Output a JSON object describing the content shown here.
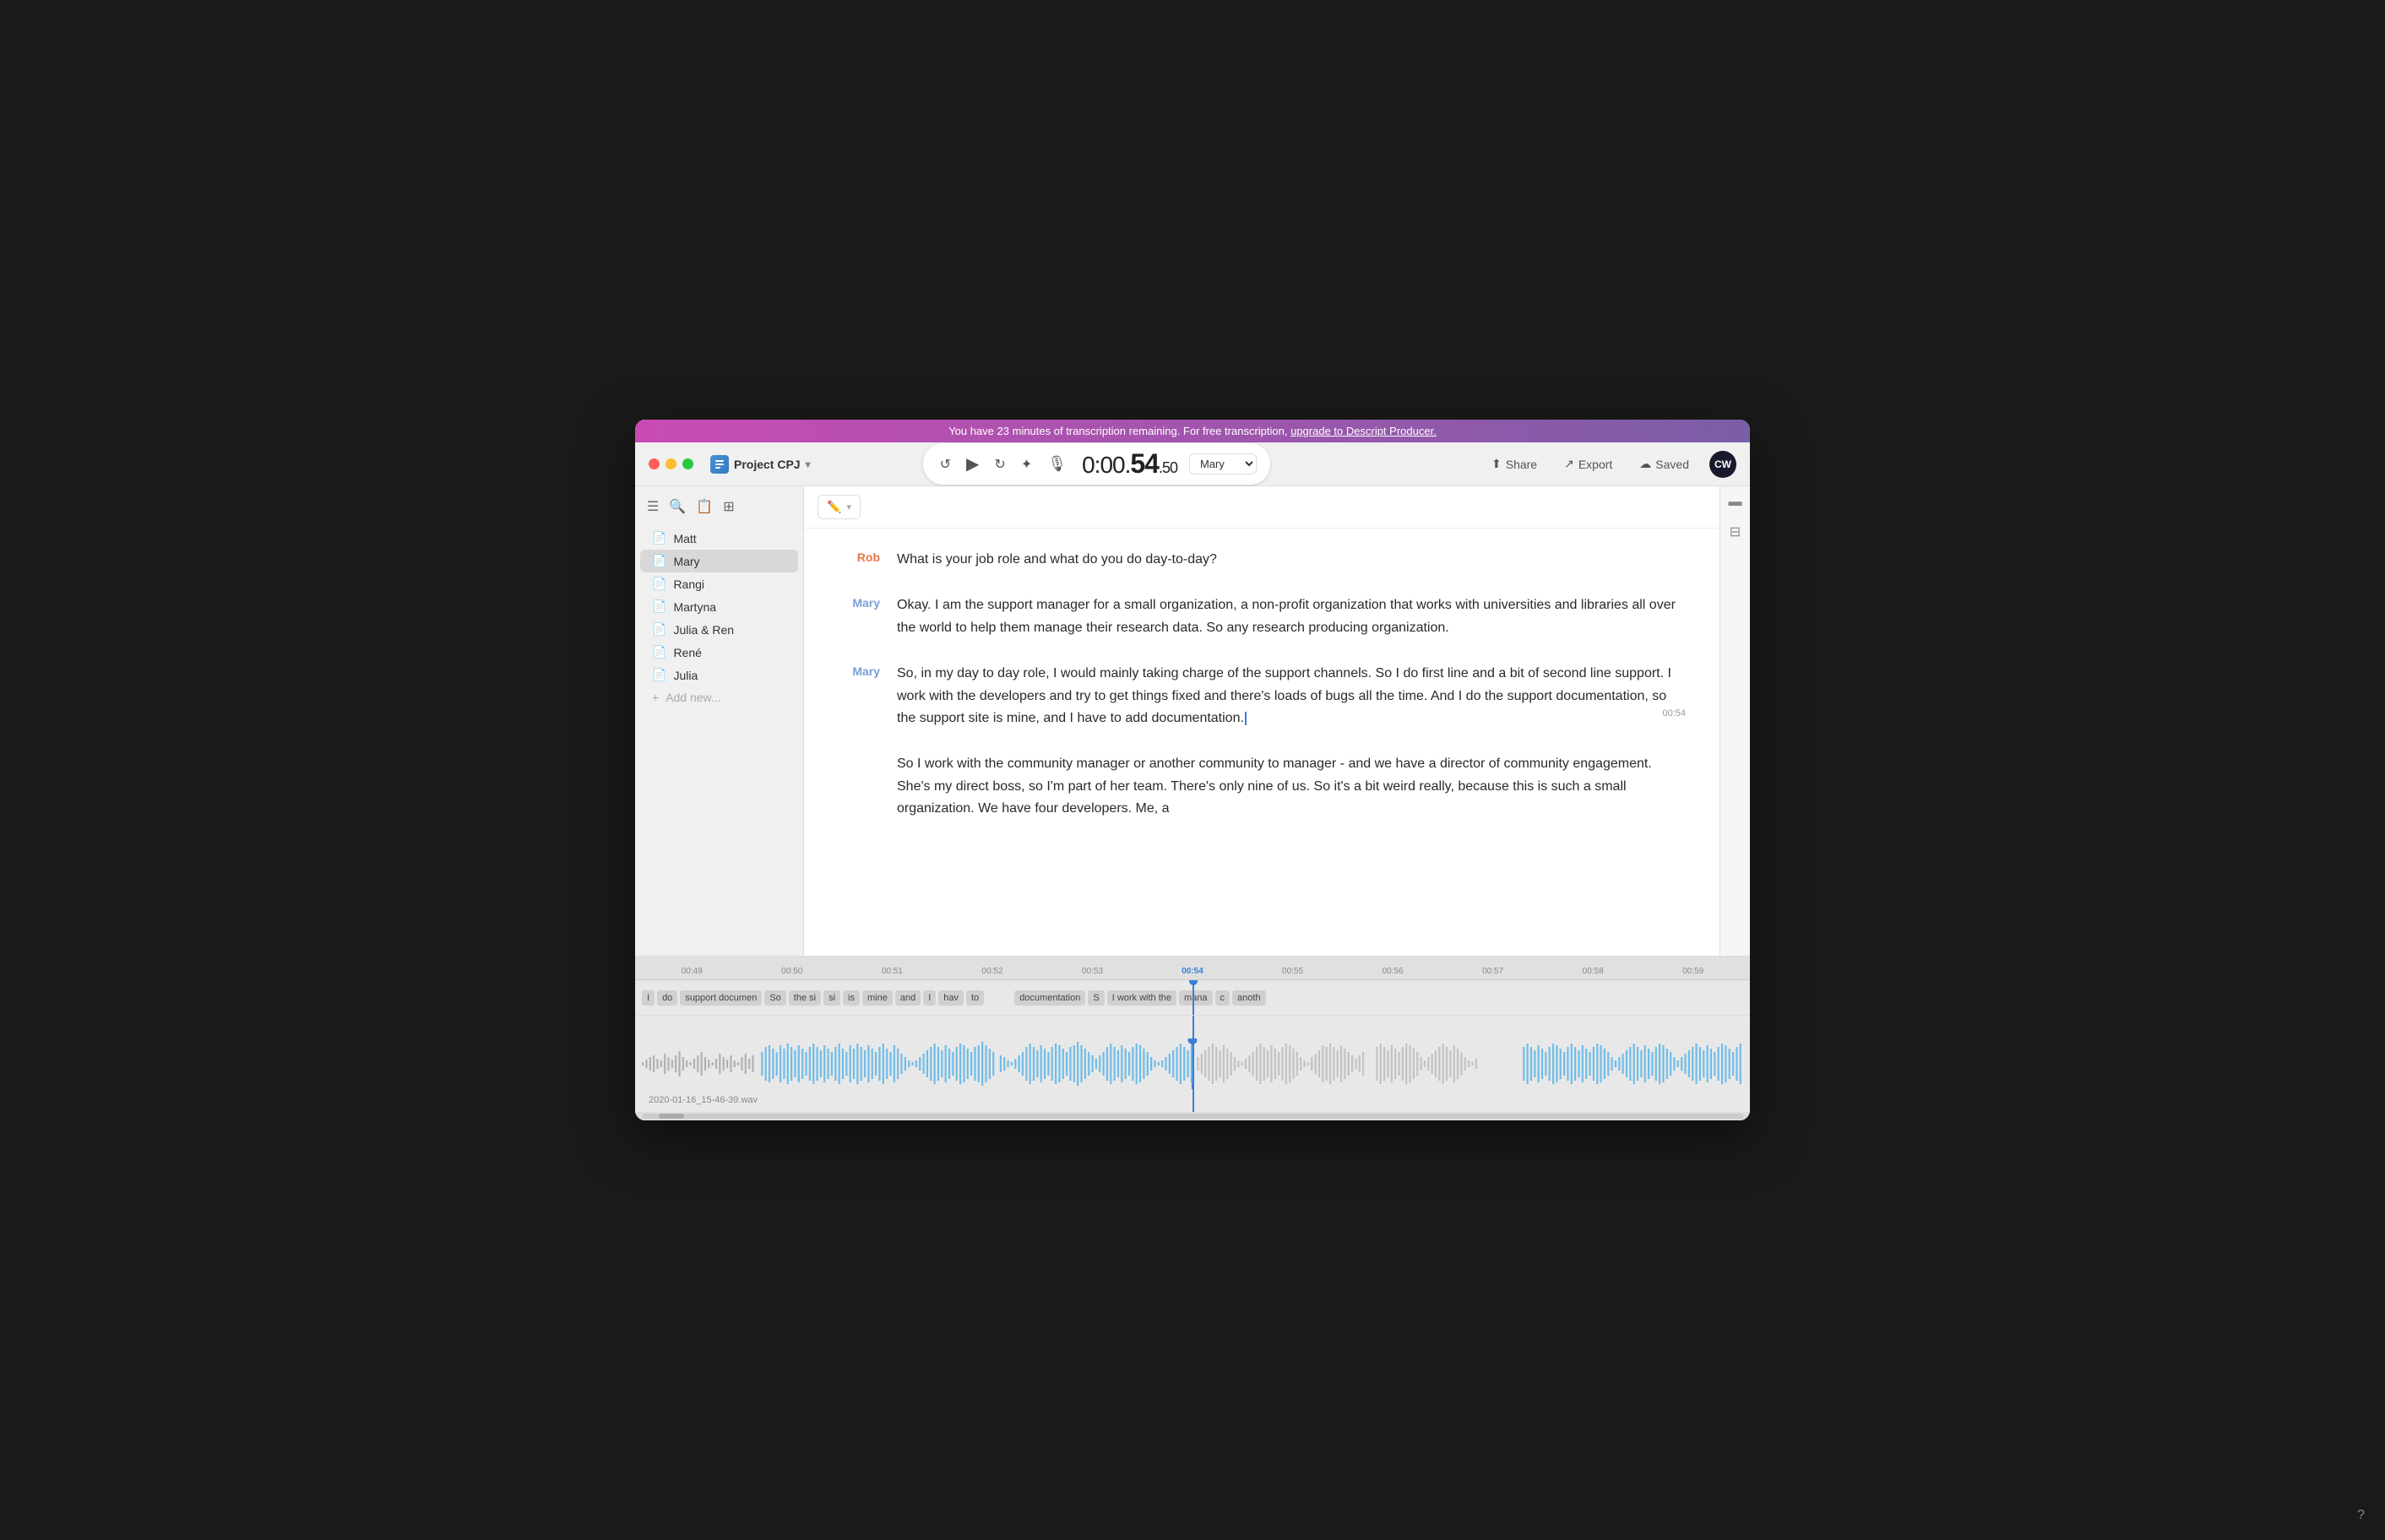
{
  "banner": {
    "text": "You have 23 minutes of transcription remaining. For free transcription, ",
    "link_text": "upgrade to Descript Producer.",
    "bg_start": "#c94bb4",
    "bg_end": "#7b5ea7"
  },
  "titlebar": {
    "project_name": "Project CPJ",
    "time": "0:00.",
    "time_big": "54",
    "time_small": ".50",
    "speaker_selector": "Mary",
    "share_label": "Share",
    "export_label": "Export",
    "saved_label": "Saved",
    "avatar_initials": "CW"
  },
  "sidebar": {
    "items": [
      {
        "label": "Matt",
        "active": false
      },
      {
        "label": "Mary",
        "active": true
      },
      {
        "label": "Rangi",
        "active": false
      },
      {
        "label": "Martyna",
        "active": false
      },
      {
        "label": "Julia & Ren",
        "active": false
      },
      {
        "label": "René",
        "active": false
      },
      {
        "label": "Julia",
        "active": false
      }
    ],
    "add_label": "Add new..."
  },
  "transcript": {
    "blocks": [
      {
        "speaker": "Rob",
        "speaker_class": "speaker-rob",
        "text": "What is your job role and what do you do day-to-day?"
      },
      {
        "speaker": "Mary",
        "speaker_class": "speaker-mary",
        "text": "Okay. I am the support manager for a small organization, a non-profit organization that works with universities and libraries all over the world to help them manage their research data. So any research producing organization."
      },
      {
        "speaker": "Mary",
        "speaker_class": "speaker-mary",
        "text": "So, in my day to day role, I would mainly taking charge of the support channels. So I do first line and a bit of second line support.  I work with the developers and try to get things fixed and there's loads of bugs all the time. And I do the support  documentation, so the support site is mine, and I have to add documentation.",
        "timestamp": "00:54",
        "has_cursor": true
      },
      {
        "speaker": "",
        "speaker_class": "",
        "text": "So I work with the community manager or another community to manager - and we have a director of community engagement. She's my direct boss, so I'm part of her team. There's only nine of us. So it's a bit weird really, because this is such a small organization. We have four developers. Me, a"
      }
    ]
  },
  "timeline": {
    "ruler_marks": [
      "00:49",
      "00:50",
      "00:51",
      "00:52",
      "00:53",
      "00:54",
      "00:55",
      "00:56",
      "00:57",
      "00:58",
      "00:59"
    ],
    "word_chips": [
      {
        "label": "I",
        "active": false
      },
      {
        "label": "do",
        "active": false
      },
      {
        "label": "support documen",
        "active": false
      },
      {
        "label": "So",
        "active": false
      },
      {
        "label": "the si",
        "active": false
      },
      {
        "label": "si",
        "active": false
      },
      {
        "label": "is",
        "active": false
      },
      {
        "label": "mine",
        "active": false
      },
      {
        "label": "and",
        "active": false
      },
      {
        "label": "I",
        "active": false
      },
      {
        "label": "hav",
        "active": false
      },
      {
        "label": "to",
        "active": false
      },
      {
        "label": "",
        "active": false
      },
      {
        "label": "documentation",
        "active": false
      },
      {
        "label": "S",
        "active": false
      },
      {
        "label": "I work with the",
        "active": false
      },
      {
        "label": "mana",
        "active": false
      },
      {
        "label": "c",
        "active": false
      },
      {
        "label": "anoth",
        "active": false
      }
    ],
    "filename": "2020-01-16_15-46-39.wav"
  }
}
